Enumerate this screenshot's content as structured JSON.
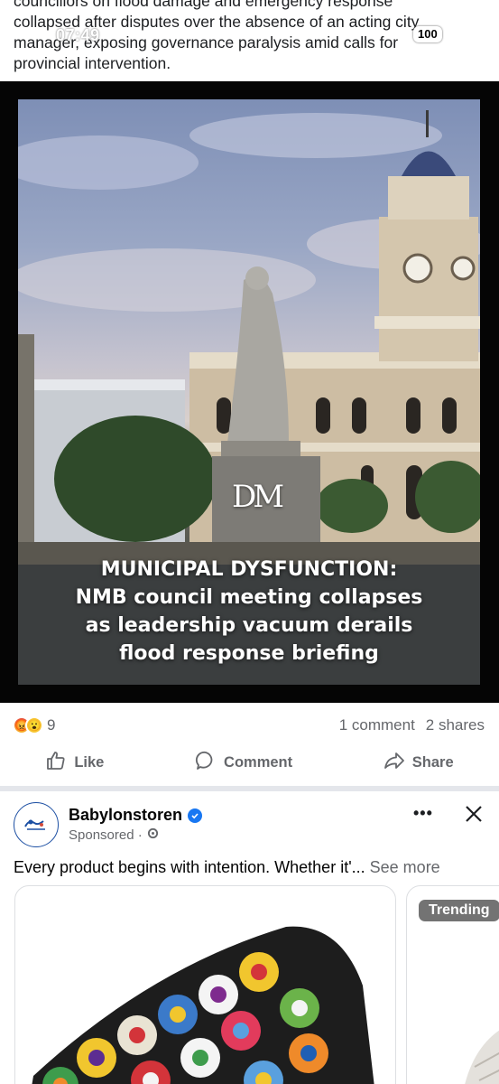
{
  "status_bar": {
    "time": "07:49",
    "battery": "100"
  },
  "post": {
    "text_lines": [
      "councillors on flood damage and emergency response",
      "collapsed after disputes over the absence of an acting city",
      "manager, exposing governance paralysis amid calls for",
      "provincial intervention."
    ],
    "image": {
      "logo": "DM",
      "caption_lines": [
        "MUNICIPAL DYSFUNCTION:",
        "NMB council meeting collapses",
        "as leadership vacuum derails",
        "flood response briefing"
      ]
    },
    "reaction_count": "9",
    "comments": "1 comment",
    "shares": "2 shares",
    "actions": {
      "like": "Like",
      "comment": "Comment",
      "share": "Share"
    }
  },
  "sponsored": {
    "name": "Babylonstoren",
    "label": "Sponsored ·",
    "text": "Every product begins with intention. Whether it'...",
    "see_more": "See more",
    "badge": "Trending",
    "icons": [
      "verified-icon",
      "globe-icon",
      "more-icon",
      "close-icon"
    ]
  },
  "colors": {
    "accent": "#1877f2",
    "muted": "#65676b",
    "divider": "#e4e6eb"
  }
}
